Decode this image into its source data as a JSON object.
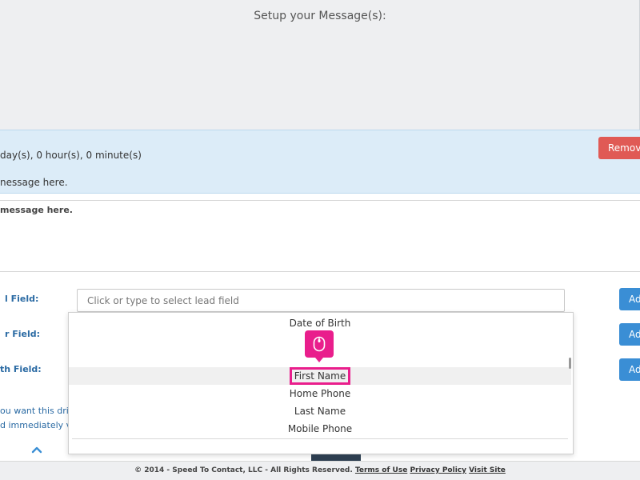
{
  "header": {
    "title": "Setup your Message(s):"
  },
  "drip": {
    "delay_text": "day(s), 0 hour(s), 0 minute(s)",
    "preview_text": "nessage here.",
    "remove_label": "Remov"
  },
  "message": {
    "placeholder": "message here."
  },
  "fields": [
    {
      "label": "l Field:",
      "add_label": "Ad"
    },
    {
      "label": "r Field:",
      "add_label": "Ad"
    },
    {
      "label": "th Field:",
      "add_label": "Ad"
    }
  ],
  "lead_select": {
    "placeholder": "Click or type to select lead field"
  },
  "dropdown": {
    "items": [
      "Date of Birth",
      "First Name",
      "Home Phone",
      "Last Name",
      "Mobile Phone"
    ],
    "selected": "First Name"
  },
  "helper": {
    "line1": "ou want this drip",
    "line2": "d immediately v"
  },
  "footer": {
    "copyright": "© 2014 - Speed To Contact, LLC - All Rights Reserved.",
    "terms": "Terms of Use",
    "privacy": "Privacy Policy",
    "visit": "Visit Site"
  },
  "colors": {
    "accent": "#3a8ed5",
    "danger": "#e05a55",
    "highlight": "#e91e8c",
    "info_band": "#dcecf8"
  },
  "icons": {
    "cursor": "mouse-icon",
    "scroll_up": "chevron-up-icon"
  }
}
